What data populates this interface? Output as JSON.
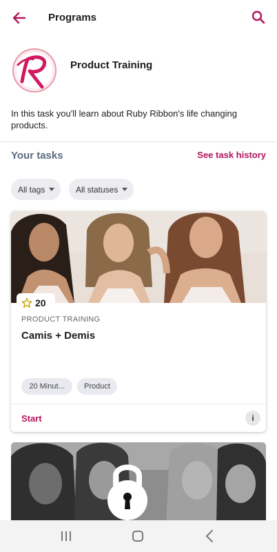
{
  "header": {
    "title": "Programs"
  },
  "program": {
    "title": "Product Training",
    "description": "In this task you'll learn about Ruby Ribbon's life changing products."
  },
  "tasks": {
    "section_label": "Your tasks",
    "history_link": "See task history",
    "filters": [
      "All tags",
      "All statuses"
    ]
  },
  "cards": [
    {
      "points": "20",
      "category": "PRODUCT TRAINING",
      "title": "Camis + Demis",
      "tags": [
        "20 Minut...",
        "Product"
      ],
      "action": "Start",
      "info": "i"
    }
  ],
  "colors": {
    "accent": "#b3155f",
    "section_label": "#5a6a80"
  },
  "icons": [
    "back-arrow-icon",
    "search-icon",
    "star-icon",
    "info-icon",
    "lock-icon",
    "recents-icon",
    "home-icon",
    "back-icon"
  ]
}
